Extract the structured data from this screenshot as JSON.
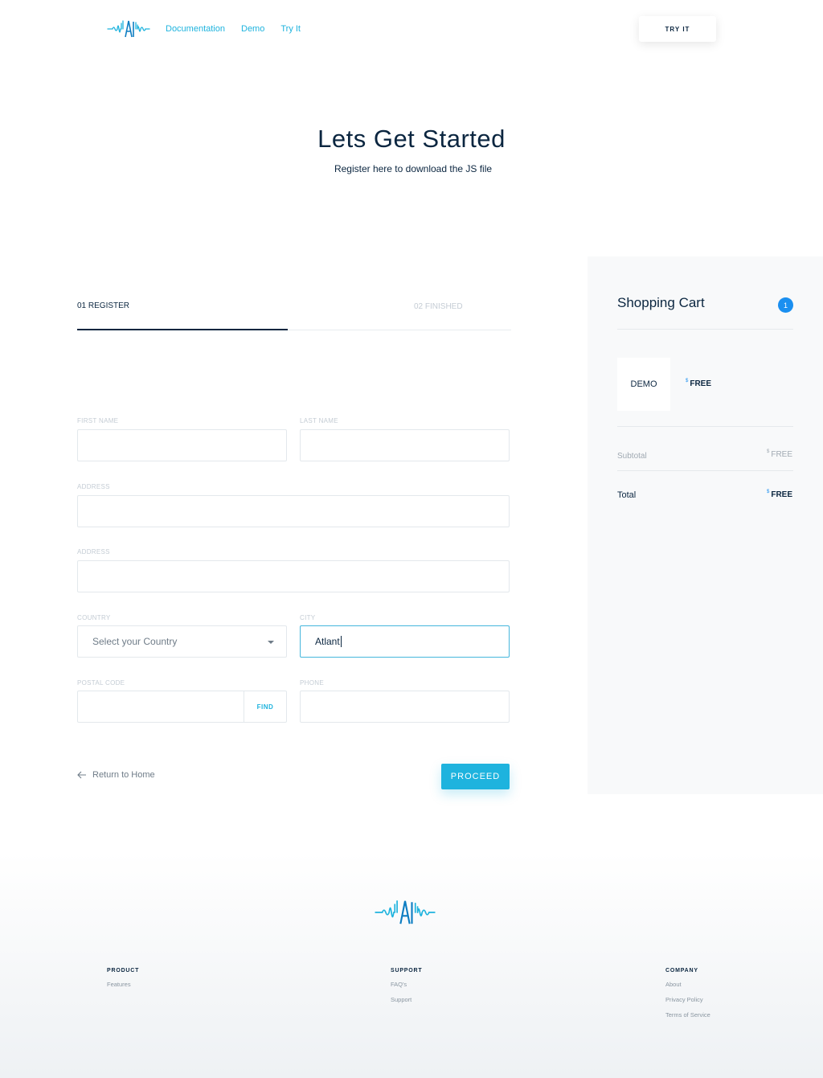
{
  "header": {
    "nav": [
      "Documentation",
      "Demo",
      "Try It"
    ],
    "cta_label": "TRY IT"
  },
  "hero": {
    "title": "Lets Get Started",
    "subtitle": "Register here to download the JS file"
  },
  "steps": {
    "step1": "01 REGISTER",
    "step2": "02 FINISHED"
  },
  "form": {
    "first_name_label": "FIRST NAME",
    "last_name_label": "LAST NAME",
    "address_label": "ADDRESS",
    "address2_label": "ADDRESS",
    "country_label": "COUNTRY",
    "country_placeholder": "Select your Country",
    "city_label": "CITY",
    "city_value": "Atlant",
    "postal_label": "POSTAL CODE",
    "find_label": "FIND",
    "phone_label": "PHONE",
    "return_label": "Return to Home",
    "proceed_label": "PROCEED"
  },
  "cart": {
    "title": "Shopping Cart",
    "count": "1",
    "item_name": "DEMO",
    "currency": "$",
    "item_price": "FREE",
    "subtotal_label": "Subtotal",
    "subtotal_value": "FREE",
    "total_label": "Total",
    "total_value": "FREE"
  },
  "footer": {
    "product": {
      "heading": "PRODUCT",
      "items": [
        "Features"
      ]
    },
    "support": {
      "heading": "SUPPORT",
      "items": [
        "FAQ's",
        "Support"
      ]
    },
    "company": {
      "heading": "COMPANY",
      "items": [
        "About",
        "Privacy Policy",
        "Terms of Service"
      ]
    }
  },
  "colors": {
    "accent": "#1eb3de",
    "navy": "#0b2640",
    "badge": "#1a8ff0"
  }
}
